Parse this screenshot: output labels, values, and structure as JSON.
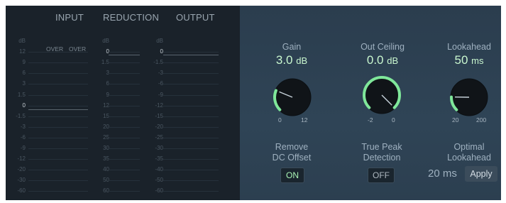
{
  "meters": {
    "headers": {
      "input": "INPUT",
      "reduction": "REDUCTION",
      "output": "OUTPUT"
    },
    "input_scale": [
      "dB",
      "12",
      "9",
      "6",
      "3",
      "1.5",
      "0",
      "-1.5",
      "-3",
      "-6",
      "-9",
      "-12",
      "-20",
      "-30",
      "-60"
    ],
    "reduction_scale": [
      "dB",
      "0",
      "1.5",
      "3",
      "6",
      "9",
      "12",
      "15",
      "20",
      "25",
      "30",
      "35",
      "40",
      "50",
      "60"
    ],
    "output_scale": [
      "dB",
      "0",
      "-1.5",
      "-3",
      "-6",
      "-9",
      "-12",
      "-15",
      "-20",
      "-25",
      "-30",
      "-35",
      "-40",
      "-50",
      "-60"
    ],
    "over_left": "OVER",
    "over_right": "OVER"
  },
  "controls": {
    "gain": {
      "label": "Gain",
      "value": "3.0",
      "unit": "dB",
      "min": "0",
      "max": "12",
      "fraction": 0.25
    },
    "out_ceiling": {
      "label": "Out Ceiling",
      "value": "0.0",
      "unit": "dB",
      "min": "-2",
      "max": "0",
      "fraction": 1.0
    },
    "lookahead": {
      "label": "Lookahead",
      "value": "50",
      "unit": "ms",
      "min": "20",
      "max": "200",
      "fraction": 0.17
    },
    "remove_dc": {
      "label_line1": "Remove",
      "label_line2": "DC Offset",
      "button": "ON"
    },
    "true_peak": {
      "label_line1": "True Peak",
      "label_line2": "Detection",
      "button": "OFF"
    },
    "optimal_lookahead": {
      "label_line1": "Optimal",
      "label_line2": "Lookahead",
      "value": "20 ms",
      "button": "Apply"
    }
  },
  "colors": {
    "accent_green": "#7fe79a",
    "knob_body": "#101418",
    "panel_blue": "#2f4456"
  }
}
